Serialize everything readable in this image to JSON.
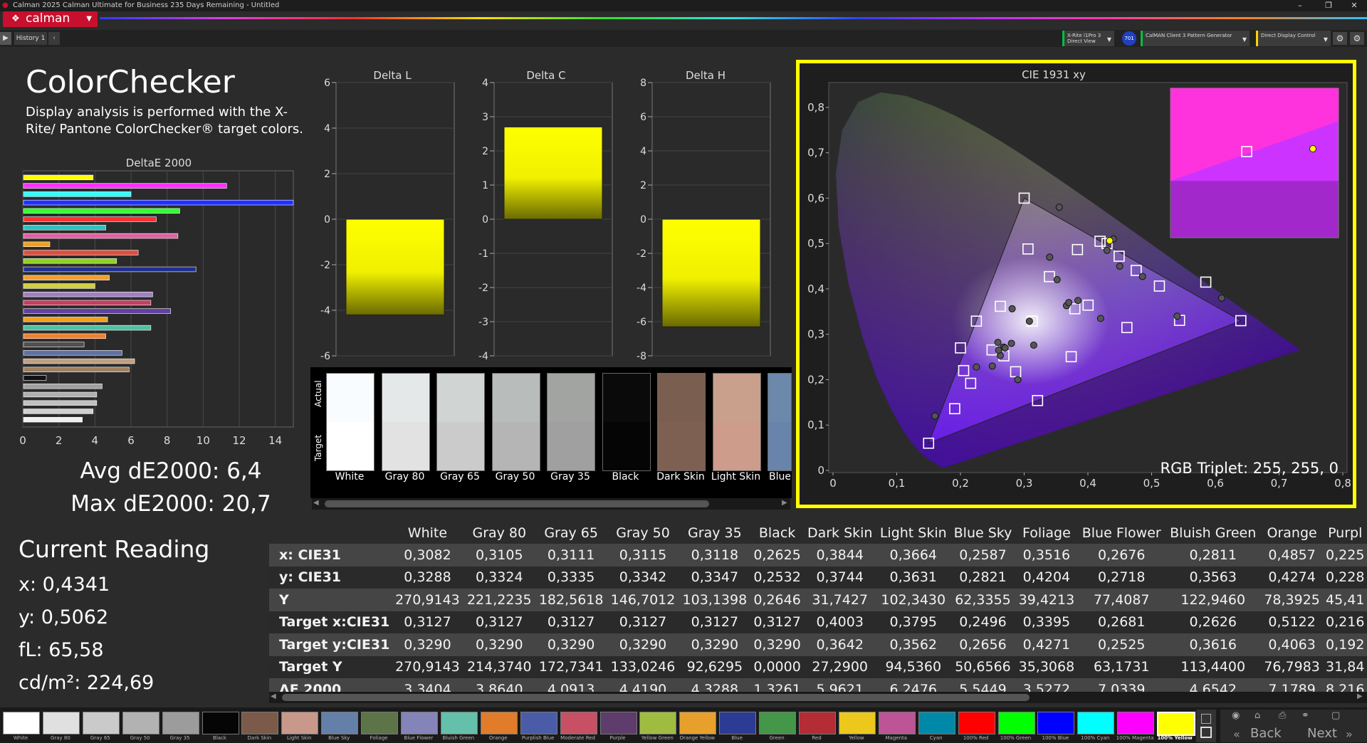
{
  "app": {
    "title": "Calman 2025 Calman Ultimate for Business 235 Days Remaining  - Untitled",
    "logo": "calman",
    "history_tab": "History 1",
    "devices": [
      {
        "line1": "X-Rite i1Pro 3",
        "line2": "Direct View",
        "badge": "701"
      },
      {
        "line1": "CalMAN Client 3 Pattern Generator",
        "line2": ""
      },
      {
        "line1": "Direct Display Control",
        "line2": ""
      }
    ]
  },
  "page": {
    "title": "ColorChecker",
    "description": "Display analysis is performed with the X-Rite/ Pantone ColorChecker® target colors.",
    "avg": "Avg dE2000: 6,4",
    "max": "Max dE2000: 20,7",
    "current_reading": {
      "heading": "Current Reading",
      "x": "x: 0,4341",
      "y": "y: 0,5062",
      "fl": "fL: 65,58",
      "cdm2": "cd/m²: 224,69"
    },
    "rgb_triplet": "RGB Triplet: 255, 255, 0"
  },
  "chart_data": [
    {
      "type": "bar",
      "title": "DeltaE 2000",
      "orientation": "horizontal",
      "xlim": [
        0,
        15
      ],
      "ticks": [
        "0",
        "2",
        "4",
        "6",
        "8",
        "10",
        "12",
        "14"
      ],
      "colors": [
        "#ffff00",
        "#ff30ff",
        "#30ffff",
        "#2030ff",
        "#30ff30",
        "#ff3030",
        "#30c0c0",
        "#e060a0",
        "#f0a020",
        "#e05040",
        "#90d020",
        "#203090",
        "#f0a030",
        "#d0d040",
        "#a080c0",
        "#c04060",
        "#6040a0",
        "#f0a020",
        "#50c0a0",
        "#f08030",
        "#505050",
        "#6070a0",
        "#c0a080",
        "#a08060",
        "#111111",
        "#a0a0a0",
        "#b0b0b0",
        "#c0c0c0",
        "#d0d0d0",
        "#f0f0f0"
      ],
      "values": [
        3.9,
        11.3,
        6.0,
        15.0,
        8.7,
        7.4,
        4.6,
        8.6,
        1.5,
        6.4,
        5.2,
        9.6,
        4.8,
        4.0,
        7.2,
        7.1,
        8.2,
        4.7,
        7.1,
        4.6,
        3.4,
        5.5,
        6.2,
        5.9,
        1.3,
        4.4,
        4.1,
        4.1,
        3.9,
        3.3
      ]
    },
    {
      "type": "bar",
      "title": "Delta L",
      "ylim": [
        -6,
        6
      ],
      "ticks": [
        "6",
        "4",
        "2",
        "0",
        "-2",
        "-4",
        "-6"
      ],
      "values": [
        -4.2
      ]
    },
    {
      "type": "bar",
      "title": "Delta C",
      "ylim": [
        -4,
        4
      ],
      "ticks": [
        "4",
        "3",
        "2",
        "1",
        "0",
        "-1",
        "-2",
        "-3",
        "-4"
      ],
      "values": [
        2.7
      ]
    },
    {
      "type": "bar",
      "title": "Delta H",
      "ylim": [
        -8,
        8
      ],
      "ticks": [
        "8",
        "6",
        "4",
        "2",
        "0",
        "-2",
        "-4",
        "-6",
        "-8"
      ],
      "values": [
        -6.3
      ]
    },
    {
      "type": "scatter",
      "title": "CIE 1931 xy",
      "xlim": [
        0,
        0.8
      ],
      "ylim": [
        0,
        0.85
      ],
      "xticks": [
        "0",
        "0,1",
        "0,2",
        "0,3",
        "0,4",
        "0,5",
        "0,6",
        "0,7",
        "0,8"
      ],
      "yticks": [
        "0",
        "0,1",
        "0,2",
        "0,3",
        "0,4",
        "0,5",
        "0,6",
        "0,7",
        "0,8"
      ],
      "gamut": [
        [
          0.64,
          0.33
        ],
        [
          0.3,
          0.6
        ],
        [
          0.15,
          0.06
        ]
      ],
      "targets": [
        [
          0.3127,
          0.329
        ],
        [
          0.4003,
          0.3642
        ],
        [
          0.3795,
          0.3562
        ],
        [
          0.2496,
          0.2656
        ],
        [
          0.3395,
          0.4271
        ],
        [
          0.2681,
          0.2525
        ],
        [
          0.2626,
          0.3616
        ],
        [
          0.5122,
          0.4063
        ],
        [
          0.216,
          0.192
        ],
        [
          0.4612,
          0.3148
        ],
        [
          0.2866,
          0.2175
        ],
        [
          0.3836,
          0.4867
        ],
        [
          0.4758,
          0.4407
        ],
        [
          0.191,
          0.136
        ],
        [
          0.306,
          0.488
        ],
        [
          0.5438,
          0.3306
        ],
        [
          0.449,
          0.472
        ],
        [
          0.3738,
          0.2506
        ],
        [
          0.2,
          0.27
        ],
        [
          0.64,
          0.33
        ],
        [
          0.3,
          0.6
        ],
        [
          0.15,
          0.06
        ],
        [
          0.225,
          0.329
        ],
        [
          0.321,
          0.154
        ],
        [
          0.419,
          0.505
        ],
        [
          0.43,
          0.5
        ],
        [
          0.585,
          0.415
        ],
        [
          0.205,
          0.22
        ]
      ],
      "actuals": [
        [
          0.3082,
          0.3288
        ],
        [
          0.3844,
          0.3744
        ],
        [
          0.3664,
          0.3631
        ],
        [
          0.2587,
          0.2821
        ],
        [
          0.3516,
          0.4204
        ],
        [
          0.2676,
          0.2718
        ],
        [
          0.2811,
          0.3563
        ],
        [
          0.4857,
          0.4274
        ],
        [
          0.225,
          0.228
        ],
        [
          0.42,
          0.335
        ],
        [
          0.315,
          0.276
        ],
        [
          0.355,
          0.58
        ],
        [
          0.44,
          0.51
        ],
        [
          0.16,
          0.12
        ],
        [
          0.34,
          0.47
        ],
        [
          0.61,
          0.38
        ],
        [
          0.43,
          0.485
        ],
        [
          0.29,
          0.2
        ],
        [
          0.25,
          0.23
        ],
        [
          0.2625,
          0.2532
        ],
        [
          0.28,
          0.28
        ],
        [
          0.27,
          0.27
        ],
        [
          0.45,
          0.45
        ],
        [
          0.37,
          0.37
        ],
        [
          0.54,
          0.34
        ],
        [
          0.26,
          0.265
        ]
      ],
      "measured": [
        0.4341,
        0.5062
      ],
      "inset_colors": [
        "#cc33ff",
        "#ff33dd"
      ]
    }
  ],
  "swatches": {
    "actual_label": "Actual",
    "target_label": "Target",
    "items": [
      {
        "name": "White",
        "actual": "#f8fcff",
        "target": "#ffffff"
      },
      {
        "name": "Gray 80",
        "actual": "#e4e8e8",
        "target": "#e2e2e2"
      },
      {
        "name": "Gray 65",
        "actual": "#d0d4d2",
        "target": "#cbcbcb"
      },
      {
        "name": "Gray 50",
        "actual": "#b8bcba",
        "target": "#b5b5b5"
      },
      {
        "name": "Gray 35",
        "actual": "#a2a4a2",
        "target": "#a0a0a0"
      },
      {
        "name": "Black",
        "actual": "#0a0a0a",
        "target": "#050505"
      },
      {
        "name": "Dark Skin",
        "actual": "#7a5e50",
        "target": "#7e6052"
      },
      {
        "name": "Light Skin",
        "actual": "#c8a08c",
        "target": "#ce9c8a"
      },
      {
        "name": "Blue",
        "actual": "#6c88aa",
        "target": "#6884aa"
      }
    ]
  },
  "table": {
    "columns": [
      "White",
      "Gray 80",
      "Gray 65",
      "Gray 50",
      "Gray 35",
      "Black",
      "Dark Skin",
      "Light Skin",
      "Blue Sky",
      "Foliage",
      "Blue Flower",
      "Bluish Green",
      "Orange",
      "Purpl"
    ],
    "rows": [
      {
        "label": "x: CIE31",
        "values": [
          "0,3082",
          "0,3105",
          "0,3111",
          "0,3115",
          "0,3118",
          "0,2625",
          "0,3844",
          "0,3664",
          "0,2587",
          "0,3516",
          "0,2676",
          "0,2811",
          "0,4857",
          "0,225"
        ]
      },
      {
        "label": "y: CIE31",
        "values": [
          "0,3288",
          "0,3324",
          "0,3335",
          "0,3342",
          "0,3347",
          "0,2532",
          "0,3744",
          "0,3631",
          "0,2821",
          "0,4204",
          "0,2718",
          "0,3563",
          "0,4274",
          "0,228"
        ]
      },
      {
        "label": "Y",
        "values": [
          "270,9143",
          "221,2235",
          "182,5618",
          "146,7012",
          "103,1398",
          "0,2646",
          "31,7427",
          "102,3430",
          "62,3355",
          "39,4213",
          "77,4087",
          "122,9460",
          "78,3925",
          "45,41"
        ]
      },
      {
        "label": "Target x:CIE31",
        "values": [
          "0,3127",
          "0,3127",
          "0,3127",
          "0,3127",
          "0,3127",
          "0,3127",
          "0,4003",
          "0,3795",
          "0,2496",
          "0,3395",
          "0,2681",
          "0,2626",
          "0,5122",
          "0,216"
        ]
      },
      {
        "label": "Target y:CIE31",
        "values": [
          "0,3290",
          "0,3290",
          "0,3290",
          "0,3290",
          "0,3290",
          "0,3290",
          "0,3642",
          "0,3562",
          "0,2656",
          "0,4271",
          "0,2525",
          "0,3616",
          "0,4063",
          "0,192"
        ]
      },
      {
        "label": "Target Y",
        "values": [
          "270,9143",
          "214,3740",
          "172,7341",
          "133,0246",
          "92,6295",
          "0,0000",
          "27,2900",
          "94,5360",
          "50,6566",
          "35,3068",
          "63,1731",
          "113,4400",
          "76,7983",
          "31,84"
        ]
      },
      {
        "label": "ΔE 2000",
        "values": [
          "3,3404",
          "3,8640",
          "4,0913",
          "4,4190",
          "4,3288",
          "1,3261",
          "5,9621",
          "6,2476",
          "5,5449",
          "3,5272",
          "7,0339",
          "4,6542",
          "7,1789",
          "8,216"
        ]
      }
    ]
  },
  "patch_bar": {
    "items": [
      {
        "label": "White",
        "color": "#ffffff"
      },
      {
        "label": "Gray 80",
        "color": "#e0e0e0"
      },
      {
        "label": "Gray 65",
        "color": "#cacaca"
      },
      {
        "label": "Gray 50",
        "color": "#b2b2b2"
      },
      {
        "label": "Gray 35",
        "color": "#9c9c9c"
      },
      {
        "label": "Black",
        "color": "#050505"
      },
      {
        "label": "Dark Skin",
        "color": "#7b5a4a"
      },
      {
        "label": "Light Skin",
        "color": "#c8988a"
      },
      {
        "label": "Blue Sky",
        "color": "#6480a8"
      },
      {
        "label": "Foliage",
        "color": "#5c7448"
      },
      {
        "label": "Blue Flower",
        "color": "#8484b8"
      },
      {
        "label": "Bluish Green",
        "color": "#64c0aa"
      },
      {
        "label": "Orange",
        "color": "#e07c2a"
      },
      {
        "label": "Purplish Blue",
        "color": "#4a5ca8"
      },
      {
        "label": "Moderate Red",
        "color": "#c85064"
      },
      {
        "label": "Purple",
        "color": "#5e3c6c"
      },
      {
        "label": "Yellow Green",
        "color": "#a0bc40"
      },
      {
        "label": "Orange Yellow",
        "color": "#e8a02c"
      },
      {
        "label": "Blue",
        "color": "#2c3c94"
      },
      {
        "label": "Green",
        "color": "#449648"
      },
      {
        "label": "Red",
        "color": "#b42c34"
      },
      {
        "label": "Yellow",
        "color": "#ecc81c"
      },
      {
        "label": "Magenta",
        "color": "#bc5496"
      },
      {
        "label": "Cyan",
        "color": "#0088a8"
      },
      {
        "label": "100% Red",
        "color": "#ff0000"
      },
      {
        "label": "100% Green",
        "color": "#00ff00"
      },
      {
        "label": "100% Blue",
        "color": "#0000ff"
      },
      {
        "label": "100% Cyan",
        "color": "#00ffff"
      },
      {
        "label": "100% Magenta",
        "color": "#ff00ff"
      },
      {
        "label": "100% Yellow",
        "color": "#ffff00"
      }
    ],
    "back": "Back",
    "next": "Next"
  }
}
